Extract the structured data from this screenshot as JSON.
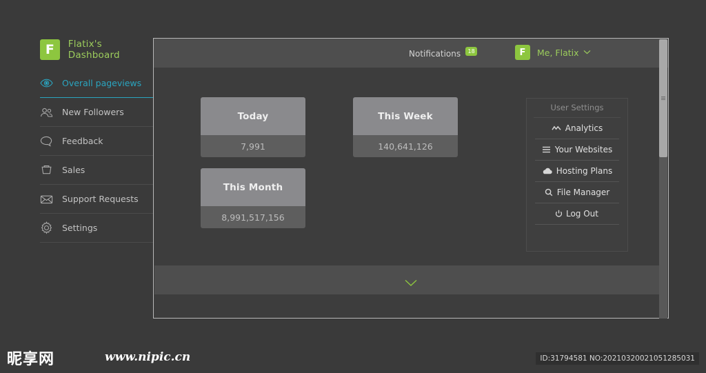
{
  "brand": {
    "logo_letter": "F",
    "title": "Flatix's Dashboard",
    "accent_green": "#8dc63f"
  },
  "sidebar": {
    "items": [
      {
        "label": "Overall pageviews",
        "icon": "eye-icon",
        "active": true
      },
      {
        "label": "New Followers",
        "icon": "users-icon",
        "active": false
      },
      {
        "label": "Feedback",
        "icon": "speech-bubble-icon",
        "active": false
      },
      {
        "label": "Sales",
        "icon": "basket-icon",
        "active": false
      },
      {
        "label": "Support Requests",
        "icon": "envelope-icon",
        "active": false
      },
      {
        "label": "Settings",
        "icon": "gear-icon",
        "active": false
      }
    ],
    "active_color": "#2aa5c0"
  },
  "topbar": {
    "notifications_label": "Notifications",
    "notifications_count": "18",
    "user_logo_letter": "F",
    "user_name": "Me, Flatix",
    "caret": "⌄"
  },
  "cards": [
    {
      "id": "card-today",
      "title": "Today",
      "value": "7,991"
    },
    {
      "id": "card-week",
      "title": "This Week",
      "value": "140,641,126"
    },
    {
      "id": "card-month",
      "title": "This Month",
      "value": "8,991,517,156"
    }
  ],
  "user_settings": {
    "header": "User Settings",
    "items": [
      {
        "label": "Analytics",
        "icon": "chart-line-icon"
      },
      {
        "label": "Your Websites",
        "icon": "list-icon"
      },
      {
        "label": "Hosting Plans",
        "icon": "cloud-icon"
      },
      {
        "label": "File Manager",
        "icon": "search-icon"
      },
      {
        "label": "Log Out",
        "icon": "power-icon"
      }
    ]
  },
  "expander": {
    "icon": "chevron-down-icon",
    "color": "#8dc63f"
  },
  "watermark": {
    "logo_text": "昵享网",
    "url": "www.nipic.cn",
    "id_text": "ID:31794581 NO:20210320021051285031"
  }
}
